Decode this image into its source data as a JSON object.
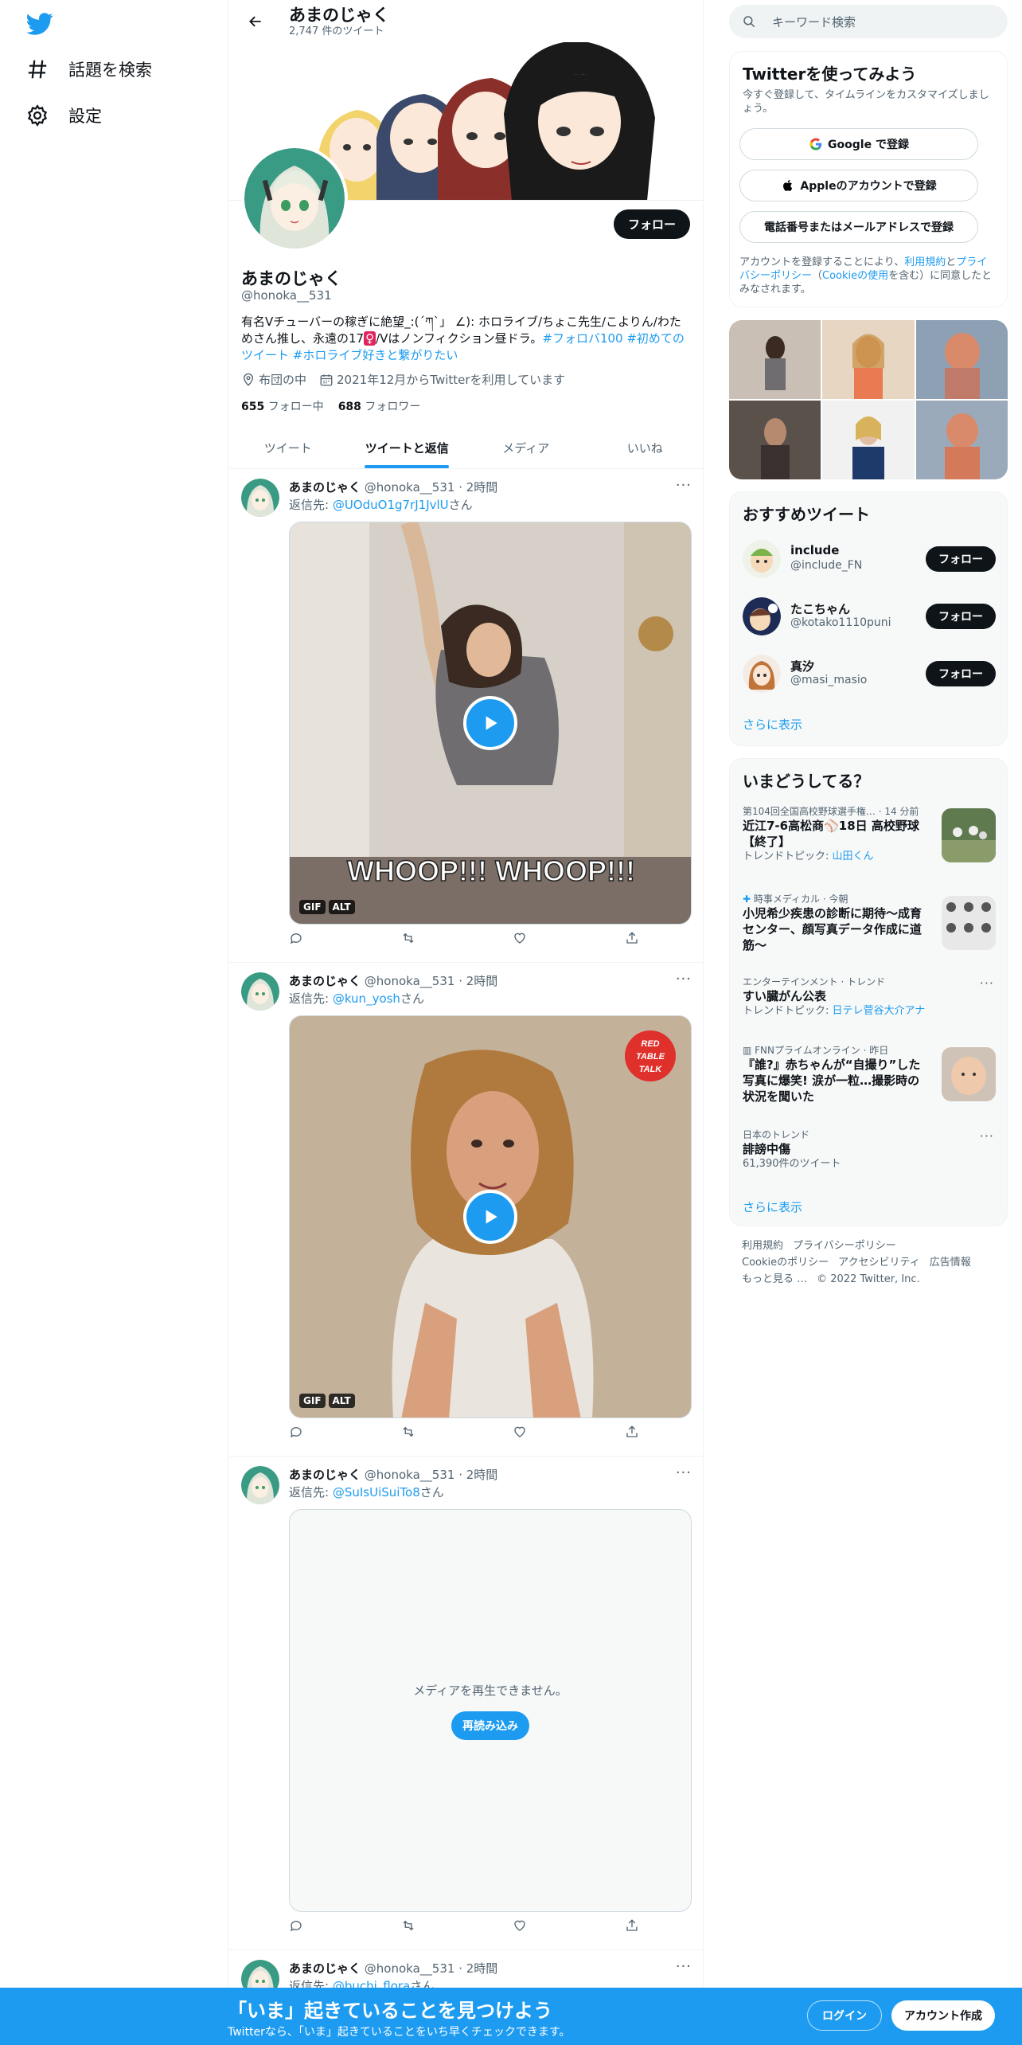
{
  "nav": {
    "explore_label": "話題を検索",
    "settings_label": "設定"
  },
  "header": {
    "name": "あまのじゃく",
    "tweet_count": "2,747 件のツイート"
  },
  "profile": {
    "follow_label": "フォロー",
    "name": "あまのじゃく",
    "handle": "@honoka__531",
    "bio_plain": "有名Vチューバーの稼ぎに絶望_:(´ཀ`」 ∠): ホロライブ/ちょこ先生/こよりん/わためさん推し、永遠の17",
    "bio_symbol": "♀",
    "bio_plain2": "/Vはノンフィクション昼ドラ。",
    "bio_tags": "#フォロバ100 #初めてのツイート #ホロライブ好きと繋がりたい",
    "location": "布団の中",
    "joined": "2021年12月からTwitterを利用しています",
    "following_count": "655",
    "following_label": "フォロー中",
    "followers_count": "688",
    "followers_label": "フォロワー"
  },
  "tabs": [
    {
      "label": "ツイート"
    },
    {
      "label": "ツイートと返信"
    },
    {
      "label": "メディア"
    },
    {
      "label": "いいね"
    }
  ],
  "tweets": [
    {
      "name": "あまのじゃく",
      "handle": "@honoka__531",
      "time": "· 2時間",
      "reply_prefix": "返信先: ",
      "reply_to": "@UOduO1g7rJ1JvlU",
      "reply_suffix": "さん",
      "media_caption": "WHOOP!!! WHOOP!!!",
      "badge_gif": "GIF",
      "badge_alt": "ALT"
    },
    {
      "name": "あまのじゃく",
      "handle": "@honoka__531",
      "time": "· 2時間",
      "reply_prefix": "返信先: ",
      "reply_to": "@kun_yosh",
      "reply_suffix": "さん",
      "stamp_lines": [
        "RED",
        "TABLE",
        "TALK"
      ],
      "badge_gif": "GIF",
      "badge_alt": "ALT"
    },
    {
      "name": "あまのじゃく",
      "handle": "@honoka__531",
      "time": "· 2時間",
      "reply_prefix": "返信先: ",
      "reply_to": "@SuIsUiSuiTo8",
      "reply_suffix": "さん",
      "error_text": "メディアを再生できません。",
      "reload_label": "再読み込み"
    },
    {
      "name": "あまのじゃく",
      "handle": "@honoka__531",
      "time": "· 2時間",
      "reply_prefix": "返信先: ",
      "reply_to": "@buchi_flora",
      "reply_suffix": "さん"
    }
  ],
  "search": {
    "placeholder": "キーワード検索"
  },
  "signup": {
    "title": "Twitterを使ってみよう",
    "subtitle": "今すぐ登録して、タイムラインをカスタマイズしましょう。",
    "google": "Google で登録",
    "apple": "Appleのアカウントで登録",
    "phone": "電話番号またはメールアドレスで登録",
    "legal_1": "アカウントを登録することにより、",
    "legal_terms": "利用規約",
    "legal_2": "と",
    "legal_privacy": "プライバシーポリシー",
    "legal_3": "（",
    "legal_cookie": "Cookieの使用",
    "legal_4": "を含む）に同意したとみなされます。"
  },
  "recommend": {
    "title": "おすすめツイート",
    "users": [
      {
        "name": "include",
        "handle": "@include_FN",
        "follow": "フォロー"
      },
      {
        "name": "たこちゃん",
        "handle": "@kotako1110puni",
        "follow": "フォロー"
      },
      {
        "name": "真汐",
        "handle": "@masi_masio",
        "follow": "フォロー"
      }
    ],
    "more": "さらに表示"
  },
  "trends": {
    "title": "いまどうしてる？",
    "items": [
      {
        "meta": "第104回全国高校野球選手権… · 14 分前",
        "title": "近江7-6高松商⚾18日 高校野球【終了】",
        "sub_prefix": "トレンドトピック: ",
        "sub_link": "山田くん"
      },
      {
        "meta": "時事メディカル · 今朝",
        "title": "小児希少疾患の診断に期待～成育センター、顔写真データ作成に道筋～"
      },
      {
        "meta": "エンターテインメント · トレンド",
        "title": "すい臓がん公表",
        "sub_prefix": "トレンドトピック: ",
        "sub_link": "日テレ菅谷大介アナ"
      },
      {
        "meta": "FNNプライムオンライン · 昨日",
        "title": "『誰?』赤ちゃんが“自撮り”した写真に爆笑! 涙が一粒…撮影時の状況を聞いた"
      },
      {
        "meta": "日本のトレンド",
        "title": "誹謗中傷",
        "sub_plain": "61,390件のツイート"
      }
    ],
    "more": "さらに表示"
  },
  "footer": {
    "terms": "利用規約",
    "privacy": "プライバシーポリシー",
    "cookie": "Cookieのポリシー",
    "accessibility": "アクセシビリティ",
    "ads": "広告情報",
    "more": "もっと見る …",
    "copyright": "© 2022 Twitter, Inc."
  },
  "bottombar": {
    "headline": "「いま」起きていることを見つけよう",
    "sub": "Twitterなら、「いま」起きていることをいち早くチェックできます。",
    "login": "ログイン",
    "signup": "アカウント作成"
  },
  "colors": {
    "accent": "#1d9bf0",
    "text": "#0f1419",
    "muted": "#536471"
  }
}
